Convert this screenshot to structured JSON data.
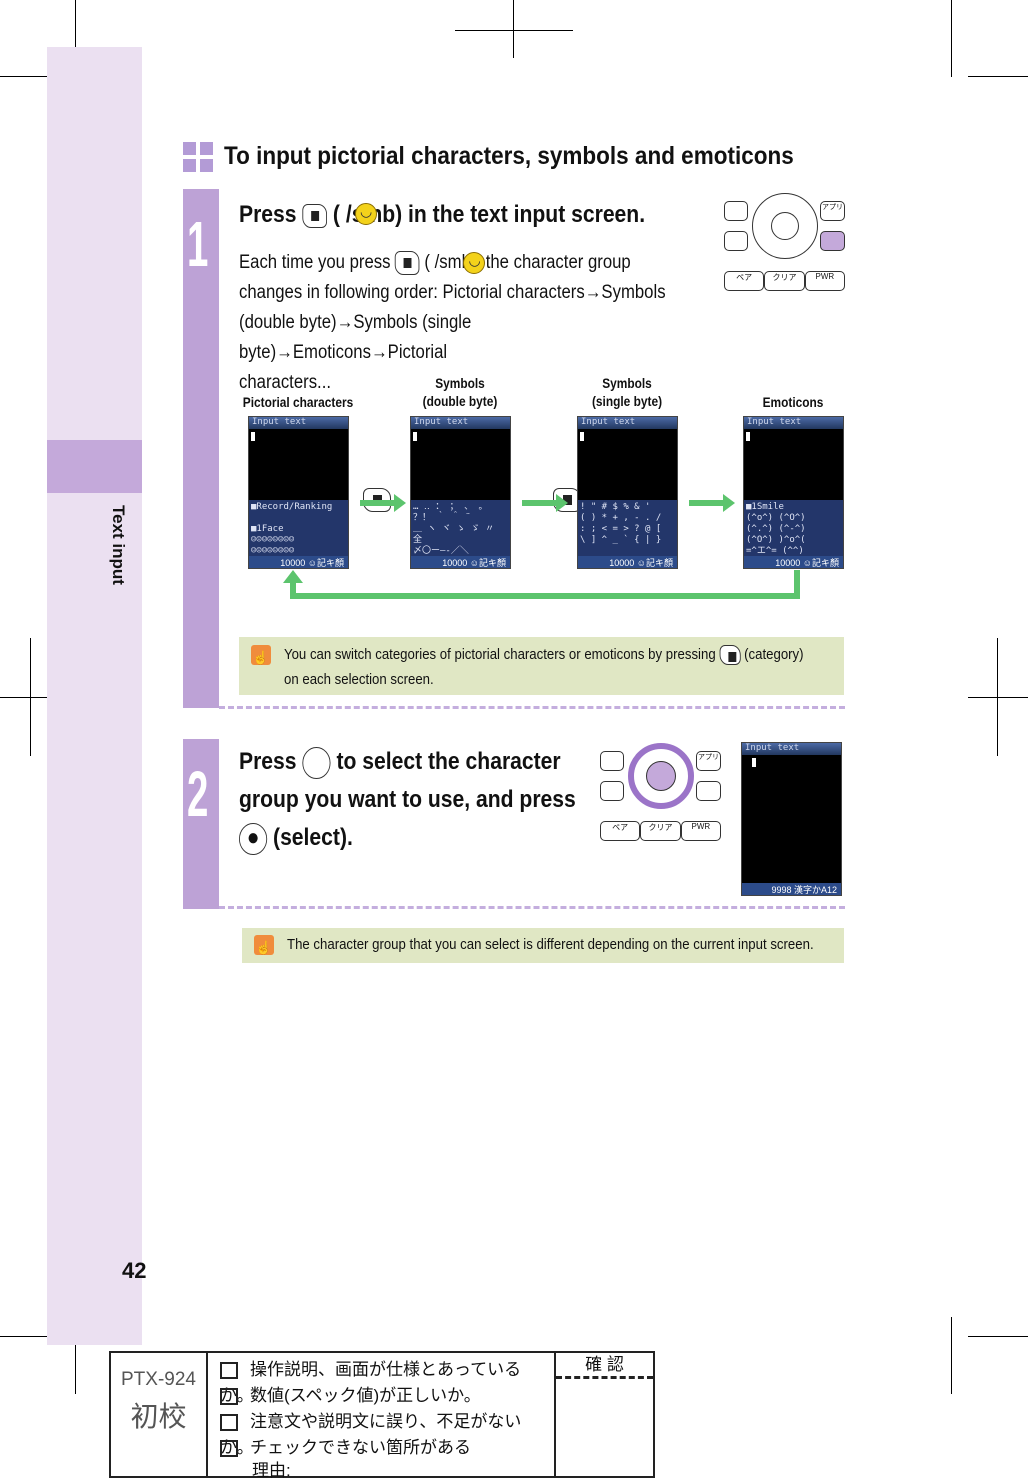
{
  "sidebar": {
    "section_label": "Text input",
    "page_number": "42"
  },
  "heading": "To input pictorial characters, symbols and emoticons",
  "step1": {
    "number": "1",
    "title_pre": "Press",
    "title_post": "(  /smb) in the text input screen.",
    "body_pre": "Each time you press",
    "body_post": "(  /smb), the character group",
    "body_lines": [
      "changes in following order: Pictorial characters→Symbols",
      "(double byte)→Symbols (single byte)→Emoticons→Pictorial",
      "characters..."
    ],
    "screens": [
      {
        "label": "Pictorial characters",
        "title": "Input text",
        "panel": [
          "■Record/Ranking",
          "",
          "■1Face",
          "☺☺☺☺☺☺☺☺",
          "☺☺☺☺☺☺☺☺"
        ],
        "status": "10000 ☺記キ顏"
      },
      {
        "label": "Symbols\n(double byte)",
        "title": "Input text",
        "panel": [
          "… ‥ ： ； 、 。",
          "？！ ｀ ＾ ¨",
          "＿ ヽ ヾ ゝ ゞ 〃 全",
          "〆〇ー―‐／＼"
        ],
        "status": "10000 ☺記キ顏"
      },
      {
        "label": "Symbols\n(single byte)",
        "title": "Input text",
        "panel": [
          "  ! \" # $ % & '",
          "( ) * + , - . /",
          ": ; < = > ? @ [",
          "\\ ] ^ _ ` { | }"
        ],
        "status": "10000 ☺記キ顏"
      },
      {
        "label": "Emoticons",
        "title": "Input text",
        "panel": [
          "■1Smile",
          "(^o^)    (^O^)",
          "(^.^)    (^-^)",
          "(^O^)    )^o^(",
          "=^エ^=   (^^)"
        ],
        "status": "10000 ☺記キ顏"
      }
    ],
    "note": {
      "line1_pre": "You can switch categories of pictorial characters or emoticons by pressing",
      "line1_post": "(category)",
      "line2": "on each selection screen."
    },
    "keypad": {
      "top_right": "アプリ",
      "bottom": [
        "ペア",
        "クリア",
        "PWR"
      ]
    }
  },
  "step2": {
    "number": "2",
    "line1_pre": "Press",
    "line1_post": "to select the character",
    "line2": "group you want to use, and press",
    "line3": "(select).",
    "screen": {
      "title": "Input text",
      "status": "9998 漢字かA12"
    }
  },
  "note2": "The character group that you can select is different depending on the current input screen.",
  "proof": {
    "model": "PTX-924",
    "stage": "初校",
    "confirm": "確 認",
    "items": [
      "操作説明、画面が仕様とあっているか。",
      "数値(スペック値)が正しいか。",
      "注意文や説明文に誤り、不足がないか。",
      "チェックできない箇所がある"
    ],
    "reason": "理由:"
  },
  "colors": {
    "sidebar": "#ebe0f1",
    "step_bar": "#bda2d6",
    "note_bg": "#e0e7c4",
    "arrow": "#5cc46d"
  }
}
